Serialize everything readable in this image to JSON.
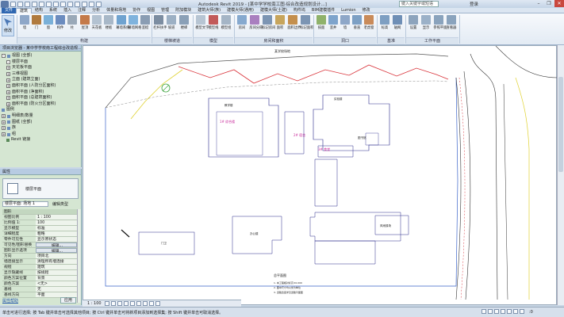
{
  "window": {
    "title": "Autodesk Revit 2019 - [某中学学校南工图·综合改造规划设计...]",
    "search_placeholder": "键入关键字或短语",
    "login": "登录"
  },
  "tabs": [
    {
      "label": "建筑",
      "active": true
    },
    {
      "label": "结构"
    },
    {
      "label": "系统"
    },
    {
      "label": "插入"
    },
    {
      "label": "注释"
    },
    {
      "label": "分析"
    },
    {
      "label": "体量和场地"
    },
    {
      "label": "协作"
    },
    {
      "label": "视图"
    },
    {
      "label": "管理"
    },
    {
      "label": "附加模块"
    },
    {
      "label": "建筑大师(族)"
    },
    {
      "label": "建模大师(通用)"
    },
    {
      "label": "建模大师(土建)"
    },
    {
      "label": "构件坞"
    },
    {
      "label": "BIM建模插件"
    },
    {
      "label": "Lumion"
    },
    {
      "label": "修改"
    }
  ],
  "ribbon": {
    "modify_label": "修改",
    "groups": [
      {
        "label": "构建"
      },
      {
        "label": "楼梯坡道"
      },
      {
        "label": "模型"
      },
      {
        "label": "房间和面积"
      },
      {
        "label": "洞口"
      },
      {
        "label": "基准"
      },
      {
        "label": "工作平面"
      }
    ],
    "buttons": [
      {
        "label": "墙",
        "color": "#8ea7c8"
      },
      {
        "label": "门",
        "color": "#b07a3e"
      },
      {
        "label": "窗",
        "color": "#7ab0d8"
      },
      {
        "label": "构件",
        "color": "#6b8cbf"
      },
      {
        "label": "柱",
        "color": "#9aa9b8"
      },
      {
        "label": "屋顶",
        "color": "#c47a4a"
      },
      {
        "label": "天花板",
        "color": "#b3c2d1"
      },
      {
        "label": "楼板",
        "color": "#a8b8c8"
      },
      {
        "label": "幕墙系统",
        "color": "#6fa3d0"
      },
      {
        "label": "幕墙网格",
        "color": "#7fb3dd"
      },
      {
        "label": "竖梃",
        "color": "#8a9db3"
      },
      {
        "label": "栏杆扶手",
        "color": "#7c8da1"
      },
      {
        "label": "坡道",
        "color": "#9cb0c4"
      },
      {
        "label": "楼梯",
        "color": "#8aa0b7"
      },
      {
        "label": "模型文字",
        "color": "#b7c5d3"
      },
      {
        "label": "模型线",
        "color": "#c25a5a"
      },
      {
        "label": "模型组",
        "color": "#a5b5c6"
      },
      {
        "label": "房间",
        "color": "#86a9cf"
      },
      {
        "label": "房间分隔",
        "color": "#a97fbf"
      },
      {
        "label": "标记房间",
        "color": "#7c95b3"
      },
      {
        "label": "面积",
        "color": "#c7a55c"
      },
      {
        "label": "面积边界",
        "color": "#c48f4d"
      },
      {
        "label": "标记面积",
        "color": "#7c95b3"
      },
      {
        "label": "按面",
        "color": "#8fb26b"
      },
      {
        "label": "竖井",
        "color": "#7ea4cc"
      },
      {
        "label": "墙",
        "color": "#8ea7c8"
      },
      {
        "label": "垂直",
        "color": "#7da0c4"
      },
      {
        "label": "老虎窗",
        "color": "#c98b5a"
      },
      {
        "label": "标高",
        "color": "#7e9fc2"
      },
      {
        "label": "轴网",
        "color": "#6f8fb6"
      },
      {
        "label": "设置",
        "color": "#8da4bd"
      },
      {
        "label": "显示",
        "color": "#9bb1c8"
      },
      {
        "label": "参照平面",
        "color": "#8aa3bd"
      },
      {
        "label": "查看器",
        "color": "#8aa3bd"
      }
    ]
  },
  "browser": {
    "title": "项目浏览器 - 某中学学校南工程综合改造规...",
    "items": [
      {
        "label": "视图 (全部)",
        "level": 0,
        "expander": "-"
      },
      {
        "label": "楼层平面",
        "level": 1,
        "expander": "-"
      },
      {
        "label": "天花板平面",
        "level": 1,
        "expander": "+"
      },
      {
        "label": "三维视图",
        "level": 1,
        "expander": "+"
      },
      {
        "label": "立面 (建筑立面)",
        "level": 1,
        "expander": "+"
      },
      {
        "label": "面积平面 (人防分区面积)",
        "level": 1,
        "expander": "+"
      },
      {
        "label": "面积平面 (净面积)",
        "level": 1,
        "expander": "+"
      },
      {
        "label": "面积平面 (总建筑面积)",
        "level": 1,
        "expander": "+"
      },
      {
        "label": "面积平面 (防火分区面积)",
        "level": 1,
        "expander": "+"
      },
      {
        "label": "图例",
        "level": 0,
        "expander": ""
      },
      {
        "label": "明细表/数量",
        "level": 0,
        "expander": "+"
      },
      {
        "label": "图纸 (全部)",
        "level": 0,
        "expander": "+"
      },
      {
        "label": "族",
        "level": 0,
        "expander": "+"
      },
      {
        "label": "组",
        "level": 0,
        "expander": "+"
      },
      {
        "label": "Revit 链接",
        "level": 0,
        "expander": ""
      }
    ]
  },
  "properties": {
    "title": "属性",
    "type_name": "楼层平面",
    "view_filter": "楼层平面: 场地 1",
    "edit_type": "编辑类型",
    "rows": [
      {
        "key": "图形",
        "value": "",
        "header": true
      },
      {
        "key": "视图比例",
        "value": "1 : 100"
      },
      {
        "key": "比例值 1:",
        "value": "100"
      },
      {
        "key": "显示模型",
        "value": "标准"
      },
      {
        "key": "详细程度",
        "value": "粗略"
      },
      {
        "key": "零件可见性",
        "value": "显示原状态"
      },
      {
        "key": "可见性/图形替换",
        "value": "编辑...",
        "button": true
      },
      {
        "key": "图形显示选项",
        "value": "编辑...",
        "button": true
      },
      {
        "key": "方向",
        "value": "项目北"
      },
      {
        "key": "墙连接显示",
        "value": "清理所有墙连接"
      },
      {
        "key": "规程",
        "value": "建筑"
      },
      {
        "key": "显示隐藏线",
        "value": "按规程"
      },
      {
        "key": "颜色方案位置",
        "value": "背景"
      },
      {
        "key": "颜色方案",
        "value": "<无>"
      },
      {
        "key": "基线",
        "value": "无"
      },
      {
        "key": "基线方向",
        "value": "平面"
      }
    ],
    "help_link": "属性帮助",
    "apply_label": "应用"
  },
  "viewbar": {
    "scale": "1 : 100"
  },
  "status": {
    "text": "单击可进行选择; 按 Tab 键并单击可选择其他项目; 按 Ctrl 键并单击可将新项目添加到选择集; 按 Shift 键并单击可取消选择。",
    "filter_count": ":0"
  },
  "drawing": {
    "site_label": "某学校场地",
    "buildings": [
      {
        "label": "教学楼"
      },
      {
        "label": "实验楼"
      },
      {
        "label": "1# 综合楼"
      },
      {
        "label": "2# 宿舍"
      },
      {
        "label": "3# 食堂"
      },
      {
        "label": "办公楼"
      },
      {
        "label": "图书馆"
      },
      {
        "label": "风雨操场"
      },
      {
        "label": "门卫"
      }
    ],
    "note_title": "总平面图",
    "notes": [
      "1. 本工程相对标高±0.000",
      "2. 图中尺寸均以米为单位",
      "3. 道路宽度详见道路平面图"
    ]
  }
}
